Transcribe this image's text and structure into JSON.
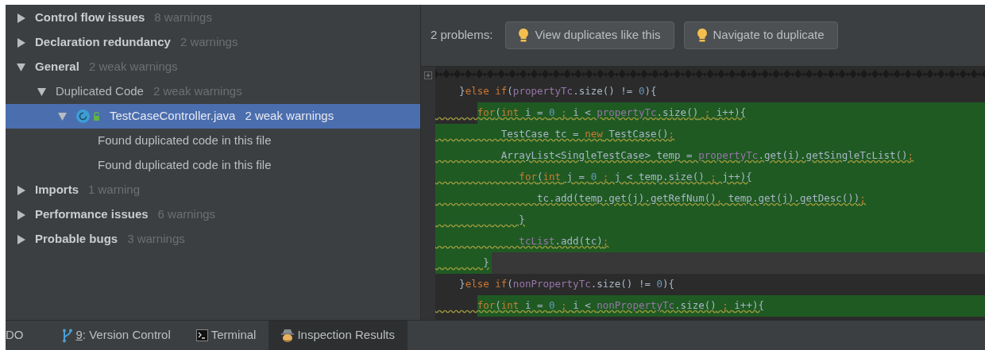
{
  "tree": [
    {
      "label": "Control flow issues",
      "count": "8 warnings",
      "kind": "category",
      "expanded": false,
      "selected": false
    },
    {
      "label": "Declaration redundancy",
      "count": "2 warnings",
      "kind": "category",
      "expanded": false,
      "selected": false
    },
    {
      "label": "General",
      "count": "2 weak warnings",
      "kind": "category",
      "expanded": true,
      "selected": false,
      "children": [
        {
          "label": "Duplicated Code",
          "count": "2 weak warnings",
          "kind": "group",
          "expanded": true,
          "selected": false,
          "children": [
            {
              "label": "TestCaseController.java",
              "count": "2 weak warnings",
              "kind": "file",
              "expanded": true,
              "selected": true,
              "children": [
                {
                  "label": "Found duplicated code in this file",
                  "kind": "problem",
                  "selected": false
                },
                {
                  "label": "Found duplicated code in this file",
                  "kind": "problem",
                  "selected": false
                }
              ]
            }
          ]
        }
      ]
    },
    {
      "label": "Imports",
      "count": "1 warning",
      "kind": "category",
      "expanded": false,
      "selected": false
    },
    {
      "label": "Performance issues",
      "count": "6 warnings",
      "kind": "category",
      "expanded": false,
      "selected": false
    },
    {
      "label": "Probable bugs",
      "count": "3 warnings",
      "kind": "category",
      "expanded": false,
      "selected": false
    }
  ],
  "problems_bar": {
    "label": "2 problems:",
    "buttons": [
      "View duplicates like this",
      "Navigate to duplicate"
    ]
  },
  "code": [
    {
      "kind": "plain",
      "current": false,
      "tokens": [
        {
          "text": "    }",
          "kind": "plain"
        },
        {
          "text": "else if",
          "kind": "keyword"
        },
        {
          "text": "(",
          "kind": "plain"
        },
        {
          "text": "propertyTc",
          "kind": "field"
        },
        {
          "text": ".size() != ",
          "kind": "plain"
        },
        {
          "text": "0",
          "kind": "number"
        },
        {
          "text": "){",
          "kind": "plain"
        }
      ]
    },
    {
      "kind": "duplicate_start",
      "current": false,
      "tokens": [
        {
          "text": "       for",
          "kind": "keyword"
        },
        {
          "text": "(",
          "kind": "plain"
        },
        {
          "text": "int",
          "kind": "keyword"
        },
        {
          "text": " i = ",
          "kind": "plain"
        },
        {
          "text": "0",
          "kind": "number"
        },
        {
          "text": " ; ",
          "kind": "keyword"
        },
        {
          "text": "i < ",
          "kind": "plain"
        },
        {
          "text": "propertyTc",
          "kind": "field"
        },
        {
          "text": ".size()",
          "kind": "plain"
        },
        {
          "text": " ; ",
          "kind": "keyword"
        },
        {
          "text": "i++){",
          "kind": "plain"
        }
      ]
    },
    {
      "kind": "duplicate",
      "current": false,
      "tokens": [
        {
          "text": "           TestCase tc = ",
          "kind": "plain"
        },
        {
          "text": "new",
          "kind": "keyword"
        },
        {
          "text": " TestCase()",
          "kind": "plain"
        },
        {
          "text": ";",
          "kind": "keyword"
        }
      ]
    },
    {
      "kind": "duplicate",
      "current": false,
      "tokens": [
        {
          "text": "           ArrayList<SingleTestCase> temp = ",
          "kind": "plain"
        },
        {
          "text": "propertyTc",
          "kind": "field"
        },
        {
          "text": ".get(i).getSingleTcList()",
          "kind": "plain"
        },
        {
          "text": ";",
          "kind": "keyword"
        }
      ]
    },
    {
      "kind": "duplicate",
      "current": false,
      "tokens": [
        {
          "text": "              for",
          "kind": "keyword"
        },
        {
          "text": "(",
          "kind": "plain"
        },
        {
          "text": "int",
          "kind": "keyword"
        },
        {
          "text": " j = ",
          "kind": "plain"
        },
        {
          "text": "0",
          "kind": "number"
        },
        {
          "text": " ; ",
          "kind": "keyword"
        },
        {
          "text": "j < temp.size()",
          "kind": "plain"
        },
        {
          "text": " ; ",
          "kind": "keyword"
        },
        {
          "text": "j++){",
          "kind": "plain"
        }
      ]
    },
    {
      "kind": "duplicate",
      "current": false,
      "tokens": [
        {
          "text": "                 tc.add(temp.get(j).getRefNum()",
          "kind": "plain"
        },
        {
          "text": ", ",
          "kind": "keyword"
        },
        {
          "text": "temp.get(j).getDesc())",
          "kind": "plain"
        },
        {
          "text": ";",
          "kind": "keyword"
        }
      ]
    },
    {
      "kind": "duplicate",
      "current": false,
      "tokens": [
        {
          "text": "              }",
          "kind": "plain"
        }
      ]
    },
    {
      "kind": "duplicate",
      "current": false,
      "tokens": [
        {
          "text": "              tcList",
          "kind": "field"
        },
        {
          "text": ".add(tc)",
          "kind": "plain"
        },
        {
          "text": ";",
          "kind": "keyword"
        }
      ]
    },
    {
      "kind": "duplicate_end",
      "current": true,
      "tokens": [
        {
          "text": "        }",
          "kind": "plain"
        }
      ]
    },
    {
      "kind": "plain",
      "current": false,
      "tokens": [
        {
          "text": "    }",
          "kind": "plain"
        },
        {
          "text": "else if",
          "kind": "keyword"
        },
        {
          "text": "(",
          "kind": "plain"
        },
        {
          "text": "nonPropertyTc",
          "kind": "field"
        },
        {
          "text": ".size() != ",
          "kind": "plain"
        },
        {
          "text": "0",
          "kind": "number"
        },
        {
          "text": "){",
          "kind": "plain"
        }
      ]
    },
    {
      "kind": "duplicate_start",
      "current": false,
      "tokens": [
        {
          "text": "       for",
          "kind": "keyword"
        },
        {
          "text": "(",
          "kind": "plain"
        },
        {
          "text": "int",
          "kind": "keyword"
        },
        {
          "text": " i = ",
          "kind": "plain"
        },
        {
          "text": "0",
          "kind": "number"
        },
        {
          "text": " ; ",
          "kind": "keyword"
        },
        {
          "text": "i < ",
          "kind": "plain"
        },
        {
          "text": "nonPropertyTc",
          "kind": "field"
        },
        {
          "text": ".size()",
          "kind": "plain"
        },
        {
          "text": " ; ",
          "kind": "keyword"
        },
        {
          "text": "i++){",
          "kind": "plain"
        }
      ]
    }
  ],
  "tool_tabs": [
    {
      "kind": "todo",
      "label": "DO",
      "selected": false
    },
    {
      "kind": "vcs",
      "mnemonic": "9",
      "label": ": Version Control",
      "selected": false
    },
    {
      "kind": "terminal",
      "label": "Terminal",
      "selected": false
    },
    {
      "kind": "inspection",
      "label": "Inspection Results",
      "selected": true
    }
  ]
}
